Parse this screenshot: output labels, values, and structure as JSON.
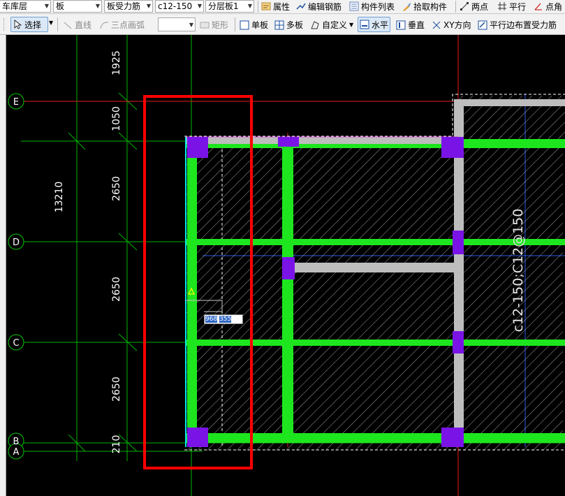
{
  "toolbar1": {
    "floor_select": "车库层",
    "type_select": "板",
    "subtype_select": "板受力筋",
    "rebar_select": "c12-150",
    "layer_select": "分层板1",
    "properties_label": "属性",
    "edit_rebar_label": "编辑钢筋",
    "component_list_label": "构件列表",
    "pick_component_label": "拾取构件",
    "two_point_label": "两点",
    "parallel_label": "平行",
    "point_angle_label": "点角"
  },
  "toolbar2": {
    "select_label": "选择",
    "line_label": "直线",
    "arc_label": "三点画弧",
    "shape_select_value": "",
    "rect_label": "矩形",
    "single_board_label": "单板",
    "multi_board_label": "多板",
    "custom_label": "自定义",
    "horizontal_label": "水平",
    "vertical_label": "垂直",
    "xy_direction_label": "XY方向",
    "parallel_edge_label": "平行边布置受力筋"
  },
  "drawing": {
    "axis_labels": [
      "E",
      "D",
      "C",
      "B",
      "A"
    ],
    "dimensions": [
      "1925",
      "1050",
      "2650",
      "2650",
      "2650",
      "210"
    ],
    "total_dimension": "13210",
    "rebar_annotation": "c12-150;C12@150",
    "coordinate_input": "968",
    "coordinate_input_2": "355"
  },
  "colors": {
    "beam": "#1ee61e",
    "column": "#7a14e6",
    "grid_line": "#00c800",
    "axis_red": "#e61e1e",
    "highlight_box": "#ff0000",
    "slab_hatch": "#c8c8c8",
    "wall_gray": "#bdbdbd"
  }
}
